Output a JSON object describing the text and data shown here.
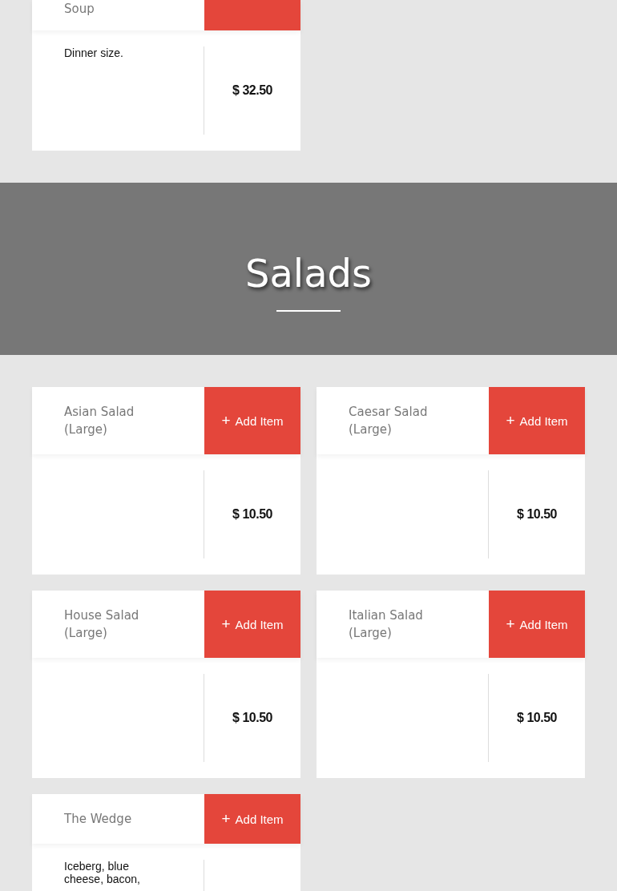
{
  "previous_items": [
    {
      "name": "Soup",
      "description": "Dinner size.",
      "price": "$ 32.50"
    }
  ],
  "category": {
    "title": "Salads"
  },
  "items": [
    {
      "name": "Asian Salad (Large)",
      "button": {
        "icon": "+",
        "label": "Add Item"
      },
      "price": "$ 10.50"
    },
    {
      "name": "Caesar Salad (Large)",
      "button": {
        "icon": "+",
        "label": "Add Item"
      },
      "price": "$ 10.50"
    },
    {
      "name": "House Salad (Large)",
      "button": {
        "icon": "+",
        "label": "Add Item"
      },
      "price": "$ 10.50"
    },
    {
      "name": "Italian Salad (Large)",
      "button": {
        "icon": "+",
        "label": "Add Item"
      },
      "price": "$ 10.50"
    },
    {
      "name": "The Wedge",
      "button": {
        "icon": "+",
        "label": "Add Item"
      },
      "description": "Iceberg, blue cheese, bacon,"
    }
  ]
}
